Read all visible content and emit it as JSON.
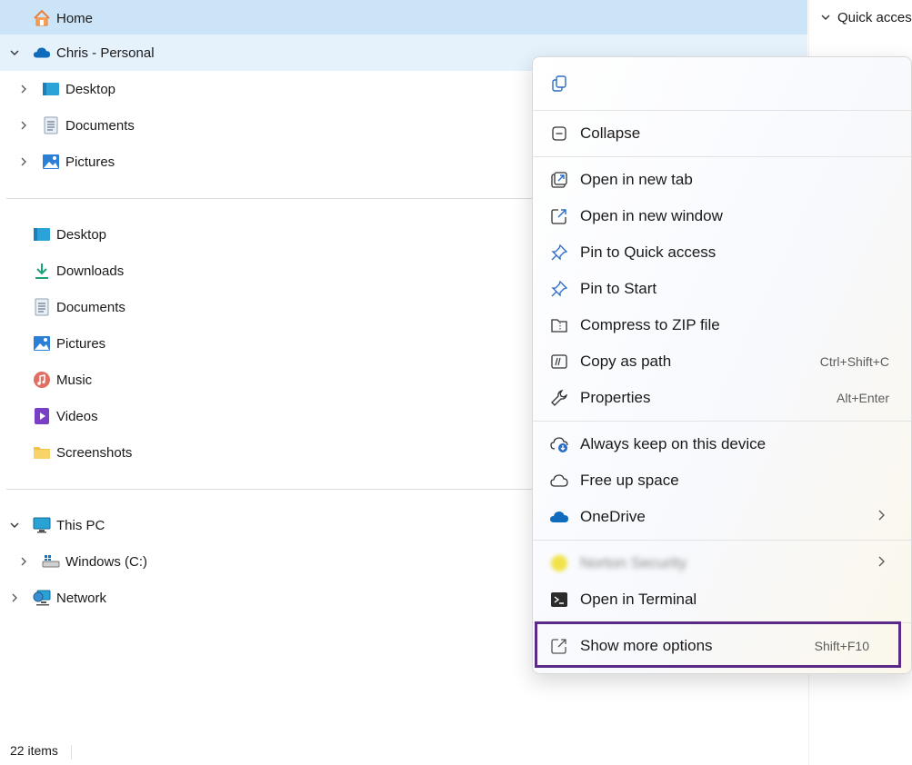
{
  "nav": {
    "home": "Home",
    "onedrive_root": "Chris - Personal",
    "onedrive_children": [
      "Desktop",
      "Documents",
      "Pictures"
    ],
    "quick": [
      "Desktop",
      "Downloads",
      "Documents",
      "Pictures",
      "Music",
      "Videos",
      "Screenshots"
    ],
    "this_pc": "This PC",
    "drive": "Windows (C:)",
    "network": "Network"
  },
  "status": {
    "count": "22 items"
  },
  "right_pane": {
    "quick_access": "Quick access"
  },
  "menu": {
    "collapse": "Collapse",
    "open_new_tab": "Open in new tab",
    "open_new_window": "Open in new window",
    "pin_quick": "Pin to Quick access",
    "pin_start": "Pin to Start",
    "compress": "Compress to ZIP file",
    "copy_path": "Copy as path",
    "copy_path_shortcut": "Ctrl+Shift+C",
    "properties": "Properties",
    "properties_shortcut": "Alt+Enter",
    "keep_device": "Always keep on this device",
    "free_space": "Free up space",
    "onedrive": "OneDrive",
    "norton": "Norton Security",
    "terminal": "Open in Terminal",
    "more_options": "Show more options",
    "more_options_shortcut": "Shift+F10"
  },
  "colors": {
    "accent": "#0078d4",
    "highlight_border": "#5b2a86",
    "selected_bg": "#cce4f7"
  }
}
